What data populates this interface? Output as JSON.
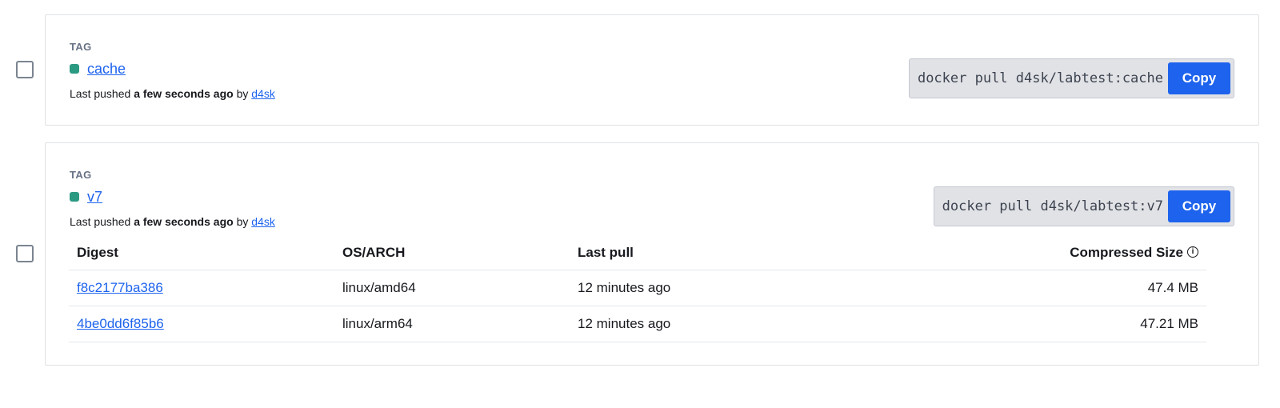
{
  "tags": [
    {
      "caption": "TAG",
      "name": "cache",
      "pushed_prefix": "Last pushed",
      "pushed_time": "a few seconds ago",
      "pushed_by_word": "by",
      "pushed_user": "d4sk",
      "pull_command": "docker pull d4sk/labtest:cache",
      "copy_label": "Copy"
    },
    {
      "caption": "TAG",
      "name": "v7",
      "pushed_prefix": "Last pushed",
      "pushed_time": "a few seconds ago",
      "pushed_by_word": "by",
      "pushed_user": "d4sk",
      "pull_command": "docker pull d4sk/labtest:v7",
      "copy_label": "Copy",
      "table": {
        "headers": {
          "digest": "Digest",
          "os_arch": "OS/ARCH",
          "last_pull": "Last pull",
          "size": "Compressed Size"
        },
        "rows": [
          {
            "digest": "f8c2177ba386",
            "os_arch": "linux/amd64",
            "last_pull": "12 minutes ago",
            "size": "47.4 MB"
          },
          {
            "digest": "4be0dd6f85b6",
            "os_arch": "linux/arm64",
            "last_pull": "12 minutes ago",
            "size": "47.21 MB"
          }
        ]
      }
    }
  ],
  "icons": {
    "status_dot": "tag-status-dot-icon",
    "info": "info-icon"
  },
  "colors": {
    "accent": "#1d63ed",
    "status_green": "#2b9a82",
    "pull_box_bg": "#e1e2e6"
  }
}
